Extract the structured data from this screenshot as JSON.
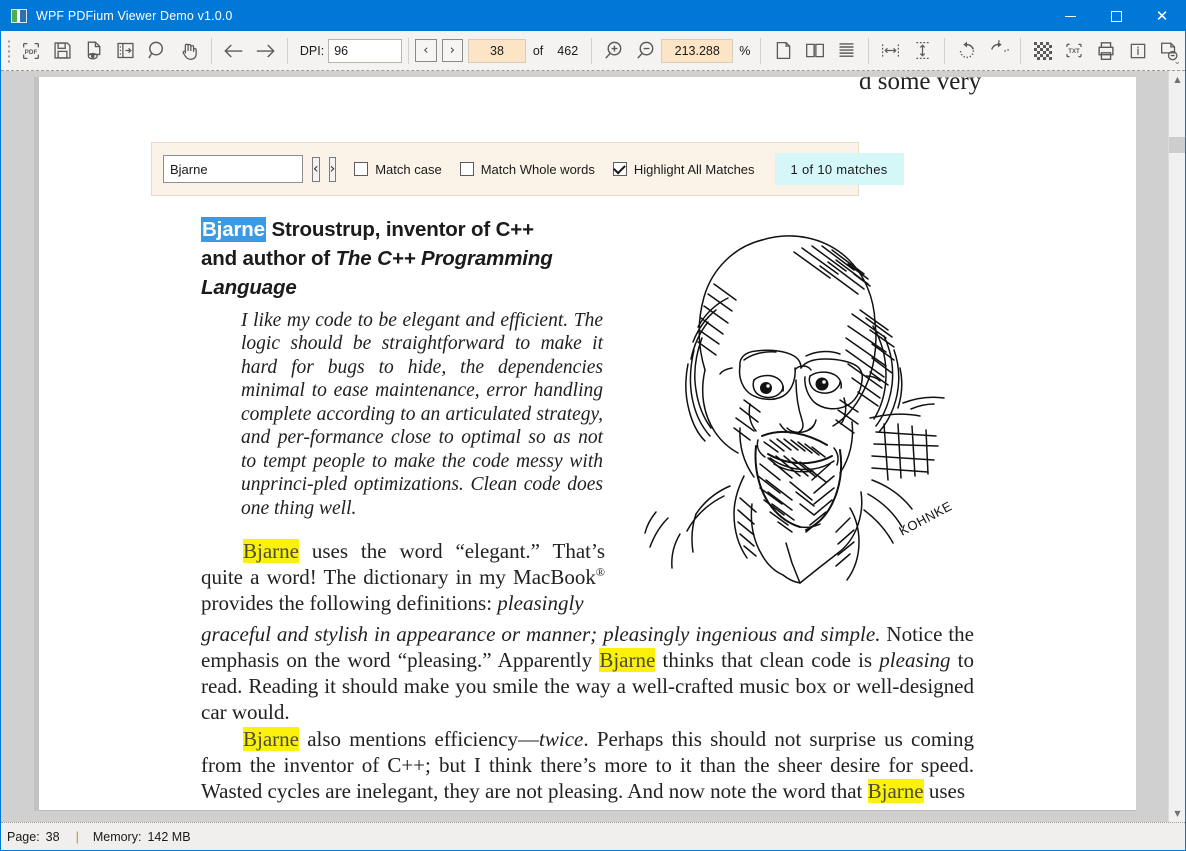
{
  "window": {
    "title": "WPF PDFium Viewer Demo v1.0.0",
    "icon": "app-icon",
    "minimize_label": "—",
    "maximize_label": "□",
    "close_label": "✕",
    "accent_color": "#0078d7"
  },
  "toolbar": {
    "icons": [
      {
        "name": "open-pdf-icon",
        "label": "PDF"
      },
      {
        "name": "save-icon",
        "label": "Save"
      },
      {
        "name": "document-preview-icon",
        "label": "Preview"
      },
      {
        "name": "toggle-sidebar-icon",
        "label": "Panel"
      },
      {
        "name": "search-icon",
        "label": "Search"
      },
      {
        "name": "pan-hand-icon",
        "label": "Pan"
      },
      {
        "name": "previous-page-arrow-icon",
        "label": "Back"
      },
      {
        "name": "next-page-arrow-icon",
        "label": "Forward"
      },
      {
        "name": "zoom-in-icon",
        "label": "Zoom In"
      },
      {
        "name": "zoom-out-icon",
        "label": "Zoom Out"
      },
      {
        "name": "single-page-icon",
        "label": "Single Page"
      },
      {
        "name": "facing-pages-icon",
        "label": "Facing Pages"
      },
      {
        "name": "continuous-pages-icon",
        "label": "Continuous"
      },
      {
        "name": "fit-width-icon",
        "label": "Fit Width"
      },
      {
        "name": "fit-height-icon",
        "label": "Fit Height"
      },
      {
        "name": "rotate-counterclockwise-icon",
        "label": "Rotate Left"
      },
      {
        "name": "rotate-clockwise-icon",
        "label": "Rotate Right"
      },
      {
        "name": "render-grid-icon",
        "label": "Render"
      },
      {
        "name": "extract-text-icon",
        "label": "TXT"
      },
      {
        "name": "print-icon",
        "label": "Print"
      },
      {
        "name": "document-info-icon",
        "label": "Info"
      },
      {
        "name": "close-document-icon",
        "label": "Close Document"
      }
    ],
    "dpi_label": "DPI:",
    "dpi_value": "96",
    "prev_page_label": "‹",
    "next_page_label": "›",
    "page_value": "38",
    "of_label": "of",
    "page_count": "462",
    "zoom_value": "213.288",
    "zoom_unit": "%",
    "overflow_label": "⌄",
    "field_highlight_color": "#fce4c7"
  },
  "search": {
    "query": "Bjarne",
    "placeholder": "",
    "find_previous_label": "‹",
    "find_next_label": "›",
    "match_case_label": "Match case",
    "match_case_checked": false,
    "match_whole_words_label": "Match Whole words",
    "match_whole_words_checked": false,
    "highlight_all_label": "Highlight All Matches",
    "highlight_all_checked": true,
    "matches_text": "1 of 10  matches",
    "matches_background": "#d6f7f7",
    "panel_background": "#fbf3e8"
  },
  "document": {
    "clipped_top_line": "d some very",
    "heading": {
      "match": "Bjarne",
      "rest_line1": " Stroustrup, inventor of C++",
      "line2_plain": "and author of ",
      "line2_italic": "The C++ Programming",
      "line3_italic": "Language"
    },
    "quote": "I like my code to be elegant and efficient. The logic should be straightforward to make it hard for bugs to hide, the dependencies minimal to ease maintenance, error handling complete according to an articulated strategy, and per-formance close to optimal so as not to tempt people to make the code messy with unprinci-pled optimizations. Clean code does one thing well.",
    "paragraph_a": {
      "match": "Bjarne",
      "text_1": " uses the word “elegant.” That’s quite a word! The dictionary in my MacBook",
      "superscript": "®",
      "text_2": " provides the following definitions: ",
      "italic_1": "pleasingly"
    },
    "paragraph_b": {
      "italic_lead": "graceful and stylish in appearance or manner; pleasingly ingenious and simple.",
      "text_1": " Notice the emphasis on the word “pleasing.” Apparently ",
      "match": "Bjarne",
      "text_2": " thinks that clean code is ",
      "italic_2": "pleasing",
      "text_3": " to read. Reading it should make you smile the way a well-crafted music box or well-designed car would."
    },
    "paragraph_c": {
      "match_1": "Bjarne",
      "text_1": " also mentions efficiency—",
      "italic_1": "twice",
      "text_2": ". Perhaps this should not surprise us coming from the inventor of C++; but I think there’s more to it than the sheer desire for speed. Wasted cycles are inelegant, they are not pleasing. And now note the word that ",
      "match_2": "Bjarne",
      "text_3": " uses"
    },
    "portrait_alt": "Pen-and-ink portrait sketch of Bjarne Stroustrup",
    "portrait_signature": "KOHNKE",
    "current_match_color": "#3b9ae1",
    "highlight_match_color": "#fbf10a"
  },
  "scrollbar": {
    "up_label": "▲",
    "down_label": "▼"
  },
  "statusbar": {
    "page_label": "Page:",
    "page_value": "38",
    "separator": "|",
    "memory_label": "Memory:",
    "memory_value": "142 MB"
  }
}
